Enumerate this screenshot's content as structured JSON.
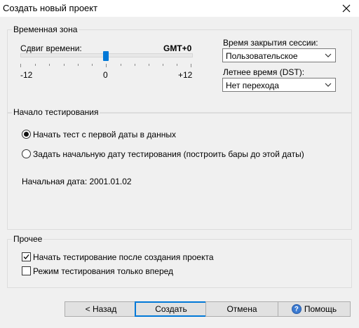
{
  "window": {
    "title": "Создать новый проект"
  },
  "timezone": {
    "group_title": "Временная зона",
    "shift_label": "Сдвиг времени:",
    "shift_value": "GMT+0",
    "slider_min": "-12",
    "slider_mid": "0",
    "slider_max": "+12",
    "slider_level": 0,
    "session_close_label": "Время закрытия сессии:",
    "session_close_value": "Пользовательское",
    "dst_label": "Летнее время (DST):",
    "dst_value": "Нет перехода"
  },
  "testing_start": {
    "group_title": "Начало тестирования",
    "option_first_date": "Начать тест с первой даты в данных",
    "option_first_date_selected": true,
    "option_set_date": "Задать начальную дату тестирования (построить бары до этой даты)",
    "option_set_date_selected": false,
    "start_date_text": "Начальная дата: 2001.01.02"
  },
  "other": {
    "group_title": "Прочее",
    "start_after_create": "Начать тестирование после создания проекта",
    "start_after_create_checked": true,
    "forward_only": "Режим тестирования только вперед",
    "forward_only_checked": false
  },
  "buttons": {
    "back": "< Назад",
    "create": "Создать",
    "cancel": "Отмена",
    "help": "Помощь"
  },
  "icons": {
    "close": "close-icon",
    "dropdown": "chevron-down-icon",
    "check": "check-icon",
    "help": "help-icon"
  },
  "colors": {
    "accent": "#0078d7",
    "dialog_bg": "#f0f0f0"
  }
}
